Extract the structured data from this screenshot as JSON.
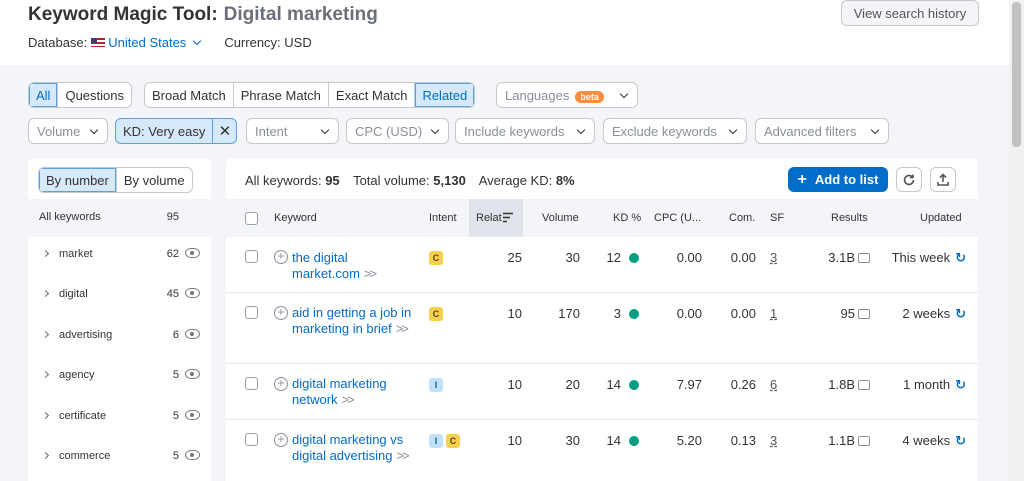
{
  "header": {
    "title": "Keyword Magic Tool:",
    "subtitle": "Digital marketing",
    "database_label": "Database:",
    "database_value": "United States",
    "currency": "Currency: USD",
    "history_button": "View search history"
  },
  "match_tabs": [
    "All",
    "Questions"
  ],
  "match_types": [
    "Broad Match",
    "Phrase Match",
    "Exact Match",
    "Related"
  ],
  "languages": {
    "label": "Languages",
    "badge": "beta"
  },
  "filters": {
    "volume": "Volume",
    "kd": "KD: Very easy",
    "kd_clear": "✕",
    "intent": "Intent",
    "cpc": "CPC (USD)",
    "include": "Include keywords",
    "exclude": "Exclude keywords",
    "advanced": "Advanced filters"
  },
  "groups_panel": {
    "toggle": [
      "By number",
      "By volume"
    ],
    "all_label": "All keywords",
    "all_count": "95",
    "items": [
      {
        "label": "market",
        "count": "62"
      },
      {
        "label": "digital",
        "count": "45"
      },
      {
        "label": "advertising",
        "count": "6"
      },
      {
        "label": "agency",
        "count": "5"
      },
      {
        "label": "certificate",
        "count": "5"
      },
      {
        "label": "commerce",
        "count": "5"
      }
    ]
  },
  "summary": {
    "all_label": "All keywords:",
    "all_value": "95",
    "volume_label": "Total volume:",
    "volume_value": "5,130",
    "kd_label": "Average KD:",
    "kd_value": "8%"
  },
  "actions": {
    "add_to_list": "Add to list"
  },
  "table": {
    "columns": [
      "Keyword",
      "Intent",
      "Relat",
      "Volume",
      "KD %",
      "CPC (U...",
      "Com.",
      "SF",
      "Results",
      "Updated"
    ],
    "rows": [
      {
        "keyword": "the digital market.com",
        "intents": [
          "C"
        ],
        "related": "25",
        "volume": "30",
        "kd": "12",
        "cpc": "0.00",
        "com": "0.00",
        "sf": "3",
        "results": "3.1B",
        "updated": "This week"
      },
      {
        "keyword": "aid in getting a job in marketing in brief",
        "intents": [
          "C"
        ],
        "related": "10",
        "volume": "170",
        "kd": "3",
        "cpc": "0.00",
        "com": "0.00",
        "sf": "1",
        "results": "95",
        "updated": "2 weeks"
      },
      {
        "keyword": "digital marketing network",
        "intents": [
          "I"
        ],
        "related": "10",
        "volume": "20",
        "kd": "14",
        "cpc": "7.97",
        "com": "0.26",
        "sf": "6",
        "results": "1.8B",
        "updated": "1 month"
      },
      {
        "keyword": "digital marketing vs digital advertising",
        "intents": [
          "I",
          "C"
        ],
        "related": "10",
        "volume": "30",
        "kd": "14",
        "cpc": "5.20",
        "com": "0.13",
        "sf": "3",
        "results": "1.1B",
        "updated": "4 weeks"
      }
    ]
  },
  "colors": {
    "accent": "#006dca",
    "kd_easy": "#009f81",
    "commercial": "#f6d04d",
    "informational": "#c0e1f8",
    "beta": "#ff8c3a"
  }
}
